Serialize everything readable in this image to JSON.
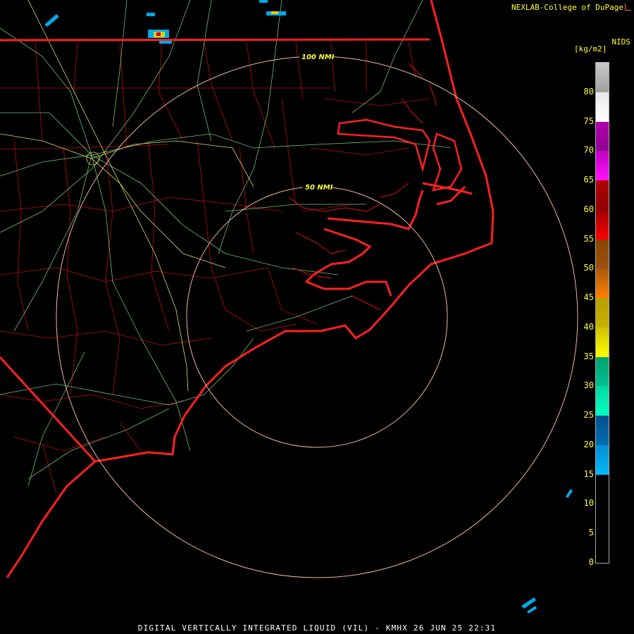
{
  "header": {
    "credit": "NEXLAB-College of DuPage",
    "product_code": "NIDS",
    "units": "[kg/m2]",
    "credit_icon": "chart-icon"
  },
  "range_rings": [
    {
      "label": "50 NMI"
    },
    {
      "label": "100 NMI"
    }
  ],
  "legend": {
    "ticks": [
      "80",
      "75",
      "70",
      "65",
      "60",
      "55",
      "50",
      "45",
      "40",
      "35",
      "30",
      "25",
      "20",
      "15",
      "10",
      "5",
      "0"
    ],
    "segments": [
      {
        "from": 80,
        "to": 85,
        "top": "#c8c8c8",
        "bottom": "#a0a0a0"
      },
      {
        "from": 75,
        "to": 80,
        "top": "#e8e8e8",
        "bottom": "#ffffff"
      },
      {
        "from": 70,
        "to": 75,
        "top": "#b000b0",
        "bottom": "#900090"
      },
      {
        "from": 65,
        "to": 70,
        "top": "#c000c0",
        "bottom": "#ff10ff"
      },
      {
        "from": 60,
        "to": 65,
        "top": "#b00000",
        "bottom": "#900000"
      },
      {
        "from": 55,
        "to": 60,
        "top": "#a00000",
        "bottom": "#ff0000"
      },
      {
        "from": 50,
        "to": 55,
        "top": "#8b4500",
        "bottom": "#9a5010"
      },
      {
        "from": 45,
        "to": 50,
        "top": "#a85a10",
        "bottom": "#ff8000"
      },
      {
        "from": 40,
        "to": 45,
        "top": "#b8a000",
        "bottom": "#c8b000"
      },
      {
        "from": 35,
        "to": 40,
        "top": "#d0c000",
        "bottom": "#ffff00"
      },
      {
        "from": 30,
        "to": 35,
        "top": "#00a070",
        "bottom": "#00c090"
      },
      {
        "from": 25,
        "to": 30,
        "top": "#00d8a0",
        "bottom": "#00ffc0"
      },
      {
        "from": 20,
        "to": 25,
        "top": "#005090",
        "bottom": "#0070b0"
      },
      {
        "from": 15,
        "to": 20,
        "top": "#0090d0",
        "bottom": "#00b8ff"
      },
      {
        "from": 0,
        "to": 15,
        "top": "#000000",
        "bottom": "#000000"
      }
    ]
  },
  "footer": "DIGITAL VERTICALLY INTEGRATED LIQUID (VIL) - KMHX 26 JUN 25 22:31",
  "colors": {
    "state_border": "#ff2020",
    "county_border": "#cc1111",
    "highway": "#88dd88",
    "interstate": "#dddd66",
    "range_ring": "#e8b8a0",
    "label": "#ffff33"
  }
}
